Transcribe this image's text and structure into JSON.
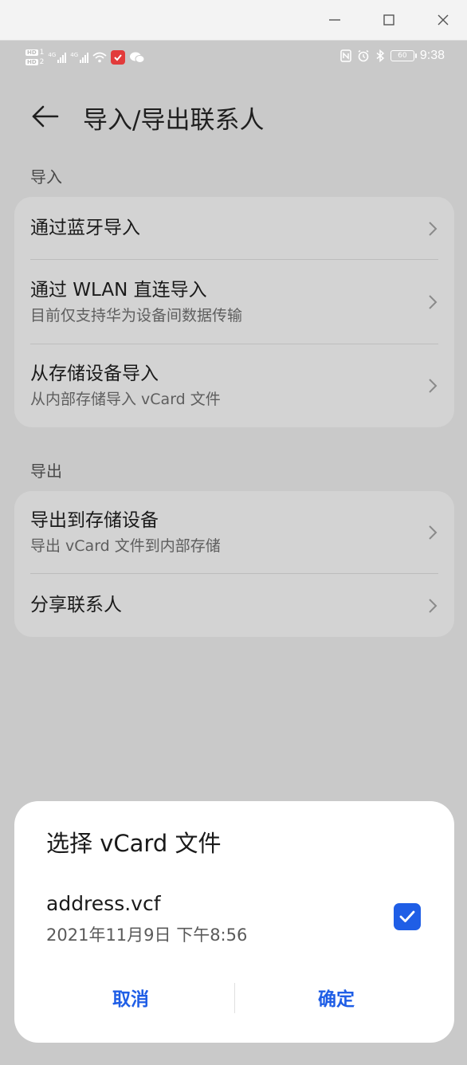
{
  "window": {
    "minimize_icon": "minimize-icon",
    "maximize_icon": "maximize-icon",
    "close_icon": "close-icon"
  },
  "status_bar": {
    "sim1": "HD",
    "sim2": "HD",
    "time": "9:38",
    "battery": "60"
  },
  "app_bar": {
    "title": "导入/导出联系人"
  },
  "import_section": {
    "label": "导入",
    "items": [
      {
        "title": "通过蓝牙导入",
        "subtitle": ""
      },
      {
        "title": "通过 WLAN 直连导入",
        "subtitle": "目前仅支持华为设备间数据传输"
      },
      {
        "title": "从存储设备导入",
        "subtitle": "从内部存储导入 vCard 文件"
      }
    ]
  },
  "export_section": {
    "label": "导出",
    "items": [
      {
        "title": "导出到存储设备",
        "subtitle": "导出 vCard 文件到内部存储"
      },
      {
        "title": "分享联系人",
        "subtitle": ""
      }
    ]
  },
  "dialog": {
    "title": "选择 vCard 文件",
    "file": {
      "name": "address.vcf",
      "date": "2021年11月9日 下午8:56",
      "checked": true
    },
    "cancel_label": "取消",
    "confirm_label": "确定"
  },
  "colors": {
    "accent": "#1f5ee6",
    "scrim_bg": "#c9c9c9",
    "card_bg": "#d3d3d3"
  }
}
